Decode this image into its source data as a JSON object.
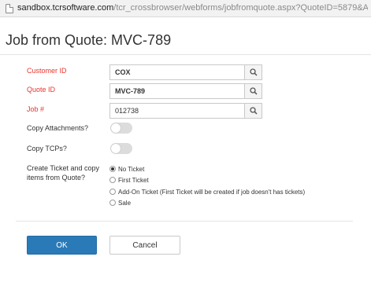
{
  "browser": {
    "url_host": "sandbox.tcrsoftware.com",
    "url_path": "/tcr_crossbrowser/webforms/jobfromquote.aspx?QuoteID=5879&AddQuoteToExisting..."
  },
  "dialog": {
    "title": "Job from Quote: MVC-789"
  },
  "form": {
    "customer_id": {
      "label": "Customer ID",
      "value": "COX"
    },
    "quote_id": {
      "label": "Quote ID",
      "value": "MVC-789"
    },
    "job_number": {
      "label": "Job #",
      "value": "012738"
    },
    "copy_attachments": {
      "label": "Copy Attachments?",
      "on": false
    },
    "copy_tcps": {
      "label": "Copy TCPs?",
      "on": false
    },
    "ticket_option": {
      "label_line1": "Create Ticket and copy",
      "label_line2": "items from Quote?",
      "options": [
        {
          "label": "No Ticket",
          "checked": true
        },
        {
          "label": "First Ticket",
          "checked": false
        },
        {
          "label": "Add-On Ticket (First Ticket will be created if job doesn't has tickets)",
          "checked": false
        },
        {
          "label": "Sale",
          "checked": false
        }
      ]
    }
  },
  "buttons": {
    "ok_label": "OK",
    "cancel_label": "Cancel"
  },
  "colors": {
    "required_label": "#e8352e",
    "primary_button": "#2a7ab8",
    "toggle_off": "#dcdcdc"
  },
  "icons": {
    "lookup": "search-icon",
    "page": "document-icon"
  }
}
